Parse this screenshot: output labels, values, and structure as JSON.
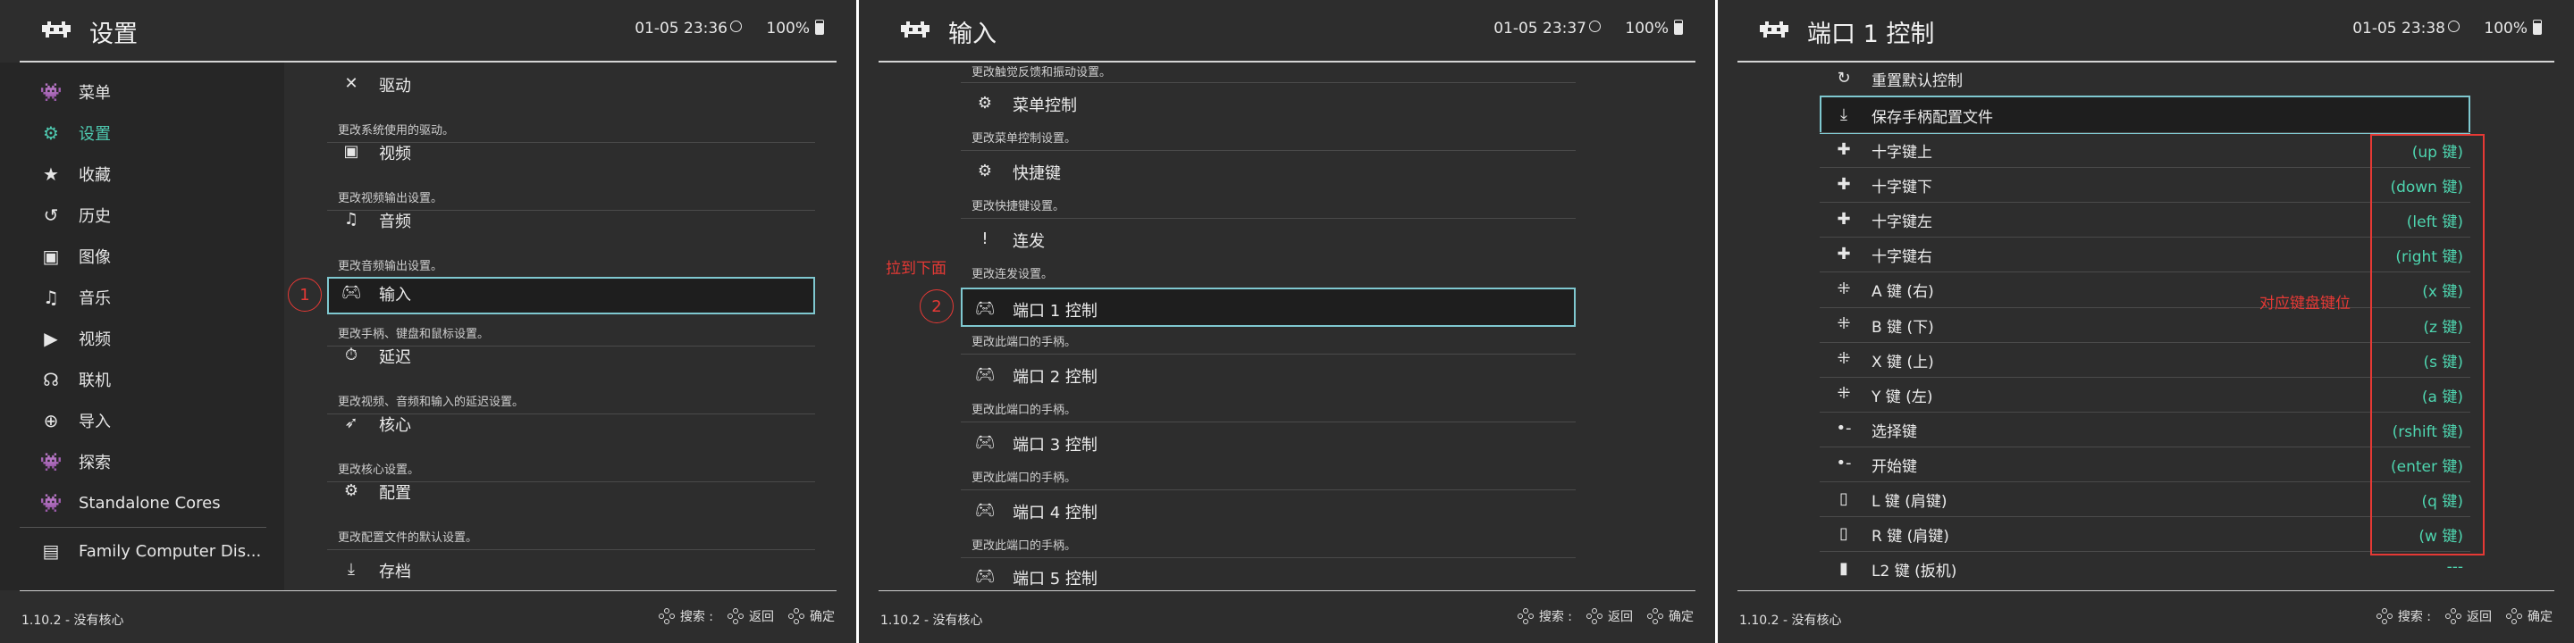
{
  "panels": [
    {
      "title": "设置",
      "time": "01-05 23:36",
      "battery": "100%"
    },
    {
      "title": "输入",
      "time": "01-05 23:37",
      "battery": "100%"
    },
    {
      "title": "端口 1 控制",
      "time": "01-05 23:38",
      "battery": "100%"
    }
  ],
  "footer": {
    "version": "1.10.2 - 没有核心",
    "search": "搜索 :",
    "back": "返回",
    "ok": "确定"
  },
  "sidebar": [
    {
      "label": "菜单",
      "icon": "retroarch-icon"
    },
    {
      "label": "设置",
      "icon": "settings-gear-icon",
      "active": true
    },
    {
      "label": "收藏",
      "icon": "star-icon"
    },
    {
      "label": "历史",
      "icon": "history-icon"
    },
    {
      "label": "图像",
      "icon": "image-icon"
    },
    {
      "label": "音乐",
      "icon": "music-icon"
    },
    {
      "label": "视频",
      "icon": "video-icon"
    },
    {
      "label": "联机",
      "icon": "netplay-icon"
    },
    {
      "label": "导入",
      "icon": "add-icon"
    },
    {
      "label": "探索",
      "icon": "retroarch-icon"
    },
    {
      "label": "Standalone Cores",
      "icon": "retroarch-icon"
    },
    {
      "label": "Family Computer Dis...",
      "icon": "console-icon"
    }
  ],
  "settings_list": [
    {
      "label": "驱动",
      "desc": "更改系统使用的驱动。",
      "icon": "tools-icon"
    },
    {
      "label": "视频",
      "desc": "更改视频输出设置。",
      "icon": "video-icon"
    },
    {
      "label": "音频",
      "desc": "更改音频输出设置。",
      "icon": "music-icon"
    },
    {
      "label": "输入",
      "desc": "更改手柄、键盘和鼠标设置。",
      "icon": "gamepad-icon",
      "selected": true
    },
    {
      "label": "延迟",
      "desc": "更改视频、音频和输入的延迟设置。",
      "icon": "timer-icon"
    },
    {
      "label": "核心",
      "desc": "更改核心设置。",
      "icon": "rocket-icon"
    },
    {
      "label": "配置",
      "desc": "更改配置文件的默认设置。",
      "icon": "gears-icon"
    },
    {
      "label": "存档",
      "desc": "",
      "icon": "download-icon"
    }
  ],
  "input_top_desc": "更改触觉反馈和振动设置。",
  "input_list": [
    {
      "label": "菜单控制",
      "desc": "更改菜单控制设置。",
      "icon": "gears-icon"
    },
    {
      "label": "快捷键",
      "desc": "更改快捷键设置。",
      "icon": "gears-icon"
    },
    {
      "label": "连发",
      "desc": "更改连发设置。",
      "icon": "turbo-icon"
    },
    {
      "label": "端口 1 控制",
      "desc": "更改此端口的手柄。",
      "icon": "gamepad-icon",
      "selected": true
    },
    {
      "label": "端口 2 控制",
      "desc": "更改此端口的手柄。",
      "icon": "gamepad-icon"
    },
    {
      "label": "端口 3 控制",
      "desc": "更改此端口的手柄。",
      "icon": "gamepad-icon"
    },
    {
      "label": "端口 4 控制",
      "desc": "更改此端口的手柄。",
      "icon": "gamepad-icon"
    },
    {
      "label": "端口 5 控制",
      "desc": "",
      "icon": "gamepad-icon"
    }
  ],
  "port_list": [
    {
      "label": "重置默认控制",
      "value": "",
      "icon": "reset-icon"
    },
    {
      "label": "保存手柄配置文件",
      "value": "",
      "icon": "download-icon",
      "selected": true
    },
    {
      "label": "十字键上",
      "value": "(up 键)",
      "icon": "dpad-icon"
    },
    {
      "label": "十字键下",
      "value": "(down 键)",
      "icon": "dpad-icon"
    },
    {
      "label": "十字键左",
      "value": "(left 键)",
      "icon": "dpad-icon"
    },
    {
      "label": "十字键右",
      "value": "(right 键)",
      "icon": "dpad-icon"
    },
    {
      "label": "A 键 (右)",
      "value": "(x 键)",
      "icon": "face-buttons-icon"
    },
    {
      "label": "B 键 (下)",
      "value": "(z 键)",
      "icon": "face-buttons-icon"
    },
    {
      "label": "X 键 (上)",
      "value": "(s 键)",
      "icon": "face-buttons-icon"
    },
    {
      "label": "Y 键 (左)",
      "value": "(a 键)",
      "icon": "face-buttons-icon"
    },
    {
      "label": "选择键",
      "value": "(rshift 键)",
      "icon": "select-icon"
    },
    {
      "label": "开始键",
      "value": "(enter 键)",
      "icon": "start-icon"
    },
    {
      "label": "L 键 (肩键)",
      "value": "(q 键)",
      "icon": "shoulder-icon"
    },
    {
      "label": "R 键 (肩键)",
      "value": "(w 键)",
      "icon": "shoulder-icon"
    },
    {
      "label": "L2 键 (扳机)",
      "value": "---",
      "icon": "trigger-icon"
    }
  ],
  "annotations": {
    "step1": "1",
    "step2": "2",
    "scroll_hint": "拉到下面",
    "key_hint": "对应键盘键位"
  },
  "colors": {
    "bg": "#2d2d2d",
    "sidebar": "#262626",
    "accent": "#4ec9b0",
    "selection_border": "#7fc8d0",
    "annotation": "#e53935"
  }
}
